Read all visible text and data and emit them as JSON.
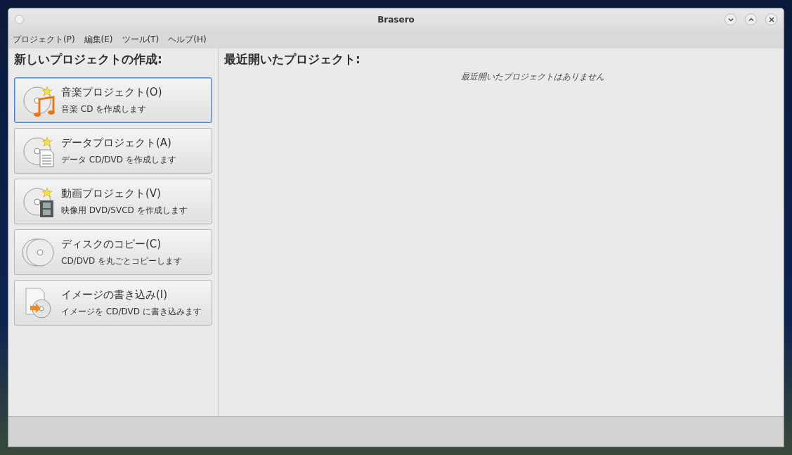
{
  "window": {
    "title": "Brasero"
  },
  "menu": [
    "プロジェクト(P)",
    "編集(E)",
    "ツール(T)",
    "ヘルプ(H)"
  ],
  "new_project": {
    "heading": "新しいプロジェクトの作成:",
    "items": [
      {
        "kind": "music",
        "title": "音楽プロジェクト(O)",
        "subtitle": "音楽 CD を作成します",
        "selected": true
      },
      {
        "kind": "data",
        "title": "データプロジェクト(A)",
        "subtitle": "データ CD/DVD を作成します",
        "selected": false
      },
      {
        "kind": "video",
        "title": "動画プロジェクト(V)",
        "subtitle": "映像用 DVD/SVCD を作成します",
        "selected": false
      },
      {
        "kind": "copy",
        "title": "ディスクのコピー(C)",
        "subtitle": "CD/DVD を丸ごとコピーします",
        "selected": false
      },
      {
        "kind": "image",
        "title": "イメージの書き込み(I)",
        "subtitle": "イメージを CD/DVD に書き込みます",
        "selected": false
      }
    ]
  },
  "recent": {
    "heading": "最近開いたプロジェクト:",
    "empty_message": "最近開いたプロジェクトはありません"
  }
}
